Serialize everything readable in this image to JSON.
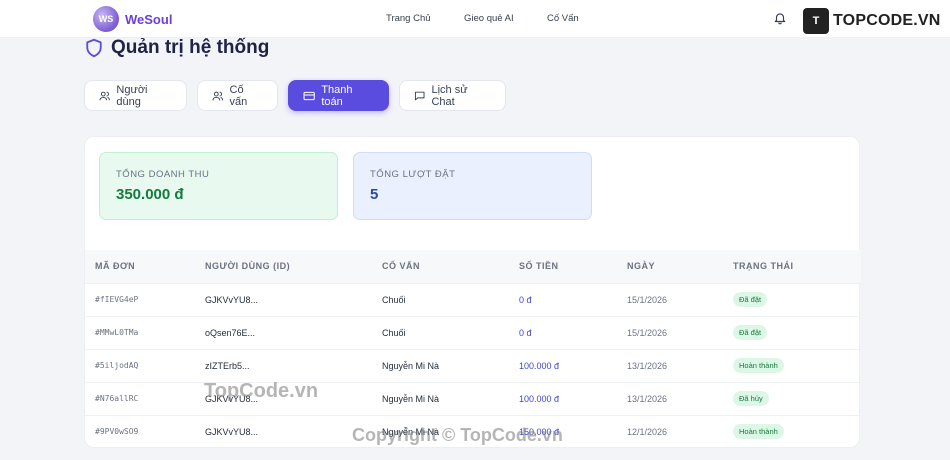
{
  "brand": {
    "logo_text": "WS",
    "name": "WeSoul"
  },
  "nav": {
    "home": "Trang Chủ",
    "ai": "Gieo quẻ AI",
    "advisor": "Cố Vấn"
  },
  "watermark": {
    "box": "T",
    "text": "TOPCODE.VN",
    "overlay1": "TopCode.vn",
    "overlay2": "Copyright © TopCode.vn"
  },
  "page": {
    "title": "Quản trị hệ thống"
  },
  "tabs": [
    {
      "label": "Người dùng",
      "icon": "users-icon"
    },
    {
      "label": "Cố vấn",
      "icon": "users-icon"
    },
    {
      "label": "Thanh toán",
      "icon": "credit-card-icon",
      "active": true
    },
    {
      "label": "Lịch sử Chat",
      "icon": "chat-icon"
    }
  ],
  "stats": {
    "revenue": {
      "label": "Tổng doanh thu",
      "value": "350.000 đ"
    },
    "bookings": {
      "label": "Tổng lượt đặt",
      "value": "5"
    }
  },
  "table": {
    "headers": [
      "MÃ ĐƠN",
      "NGƯỜI DÙNG (ID)",
      "CỐ VẤN",
      "SỐ TIỀN",
      "NGÀY",
      "TRẠNG THÁI"
    ],
    "rows": [
      {
        "code": "#fIEVG4eP",
        "user": "GJKVvYU8...",
        "advisor": "Chuối",
        "amount": "0 đ",
        "date": "15/1/2026",
        "status": "Đã đặt"
      },
      {
        "code": "#MMwL0TMa",
        "user": "oQsen76E...",
        "advisor": "Chuối",
        "amount": "0 đ",
        "date": "15/1/2026",
        "status": "Đã đặt"
      },
      {
        "code": "#5iljodAQ",
        "user": "zIZTErb5...",
        "advisor": "Nguyễn Mi Nà",
        "amount": "100.000 đ",
        "date": "13/1/2026",
        "status": "Hoàn thành"
      },
      {
        "code": "#N76allRC",
        "user": "GJKVvYU8...",
        "advisor": "Nguyễn Mi Nà",
        "amount": "100.000 đ",
        "date": "13/1/2026",
        "status": "Đã hủy"
      },
      {
        "code": "#9PV0wSO9",
        "user": "GJKVvYU8...",
        "advisor": "Nguyễn Mi Nà",
        "amount": "150.000 đ",
        "date": "12/1/2026",
        "status": "Hoàn thành"
      }
    ]
  },
  "colors": {
    "accent": "#5b4ce0",
    "brand": "#6d3fd6",
    "success": "#157a3d"
  }
}
